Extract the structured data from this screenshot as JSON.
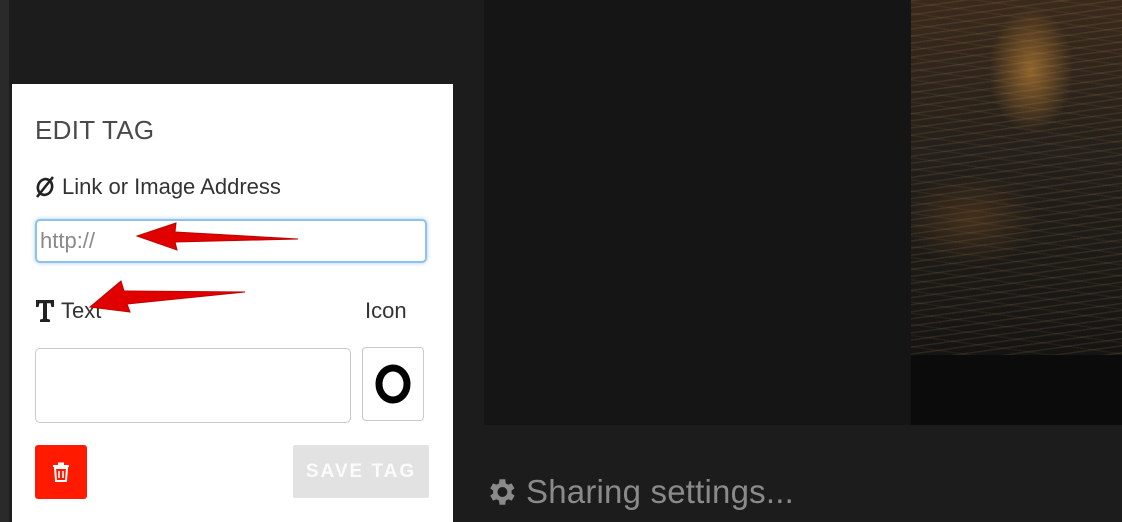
{
  "panel": {
    "title": "EDIT TAG",
    "link_label": "Link or Image Address",
    "link_icon": "link-broken-icon",
    "url_placeholder": "http://",
    "url_value": "",
    "text_label": "Text",
    "text_icon": "text-format-icon",
    "text_value": "",
    "icon_label": "Icon",
    "icon_selected": "circle-ring-icon",
    "delete_icon": "trash-icon",
    "save_label": "SAVE TAG",
    "colors": {
      "delete": "#ff1a00",
      "save_disabled": "#e2e2e2",
      "focus_border": "#8ec2ea"
    }
  },
  "footer": {
    "sharing_label": "Sharing settings...",
    "sharing_icon": "gear-icon"
  },
  "annotations": {
    "arrow_color": "#e00000",
    "count": 2
  }
}
